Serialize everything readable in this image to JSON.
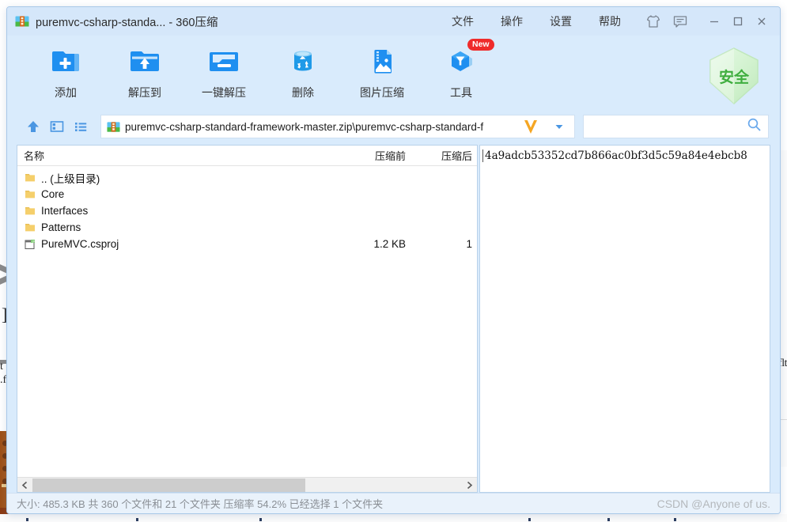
{
  "window": {
    "title": "puremvc-csharp-standa... - 360压缩",
    "icon": "archive-box-icon"
  },
  "menu": {
    "items": [
      {
        "label": "文件",
        "name": "menu-file"
      },
      {
        "label": "操作",
        "name": "menu-action"
      },
      {
        "label": "设置",
        "name": "menu-settings"
      },
      {
        "label": "帮助",
        "name": "menu-help"
      }
    ],
    "tools": [
      {
        "name": "skin-shirt-icon"
      },
      {
        "name": "feedback-message-icon"
      }
    ]
  },
  "window_controls": {
    "minimize": "minimize-icon",
    "maximize": "maximize-icon",
    "close": "close-icon"
  },
  "toolbar": {
    "buttons": [
      {
        "label": "添加",
        "icon": "folder-add-icon",
        "name": "toolbar-add",
        "badge": ""
      },
      {
        "label": "解压到",
        "icon": "folder-extract-to-icon",
        "name": "toolbar-extract-to",
        "badge": ""
      },
      {
        "label": "一键解压",
        "icon": "one-click-extract-icon",
        "name": "toolbar-one-click-extract",
        "badge": ""
      },
      {
        "label": "删除",
        "icon": "trash-delete-icon",
        "name": "toolbar-delete",
        "badge": ""
      },
      {
        "label": "图片压缩",
        "icon": "image-compress-icon",
        "name": "toolbar-image-compress",
        "badge": ""
      },
      {
        "label": "工具",
        "icon": "tools-hexagon-icon",
        "name": "toolbar-tools",
        "badge": "New"
      }
    ],
    "safe_badge": {
      "label": "安全",
      "icon": "safe-shield-icon",
      "color": "#3fae3f"
    }
  },
  "addressbar": {
    "nav": [
      {
        "name": "up-one-level-icon"
      },
      {
        "name": "preview-panel-icon"
      },
      {
        "name": "list-view-icon"
      }
    ],
    "path": "puremvc-csharp-standard-framework-master.zip\\puremvc-csharp-standard-f",
    "path_icon": "archive-box-icon",
    "dropdown_icon": "chevron-down-icon",
    "cursor_icon": "text-cursor-v-icon",
    "search": {
      "value": "",
      "placeholder": "",
      "icon": "search-icon"
    }
  },
  "filelist": {
    "columns": [
      {
        "label": "名称",
        "name": "column-name"
      },
      {
        "label": "压缩前",
        "name": "column-size-before"
      },
      {
        "label": "压缩后",
        "name": "column-size-after"
      }
    ],
    "rows": [
      {
        "name": ".. (上级目录)",
        "icon": "folder-icon",
        "size_before": "",
        "size_after": ""
      },
      {
        "name": "Core",
        "icon": "folder-icon",
        "size_before": "",
        "size_after": ""
      },
      {
        "name": "Interfaces",
        "icon": "folder-icon",
        "size_before": "",
        "size_after": ""
      },
      {
        "name": "Patterns",
        "icon": "folder-icon",
        "size_before": "",
        "size_after": ""
      },
      {
        "name": "PureMVC.csproj",
        "icon": "csproj-file-icon",
        "size_before": "1.2 KB",
        "size_after": "1"
      }
    ],
    "hscroll_icons": {
      "left": "chevron-left-icon",
      "right": "chevron-right-icon"
    }
  },
  "info_pane": {
    "hash": "4a9adcb53352cd7b866ac0bf3d5c59a84e4ebcb8"
  },
  "statusbar": {
    "text": "大小: 485.3 KB 共 360 个文件和 21 个文件夹 压缩率 54.2% 已经选择 1 个文件夹",
    "watermark": "CSDN @Anyone of us."
  },
  "background": {
    "left_text": "t\n.f",
    "right_text": "flt"
  },
  "colors": {
    "accent": "#2f8fe5",
    "titlebar": "#d5e7fa",
    "toolbar": "#d9ebfc",
    "safe_green": "#3fae3f",
    "badge_red": "#ef2b2b"
  }
}
